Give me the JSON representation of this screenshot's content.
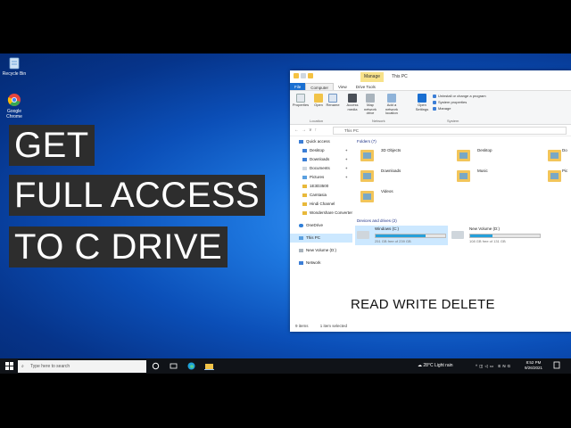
{
  "desktop": {
    "icons": [
      {
        "label": "Recycle Bin",
        "icon": "recycle-bin-icon"
      },
      {
        "label": "Google Chrome",
        "icon": "chrome-icon"
      }
    ],
    "banner": [
      "GET",
      "FULL ACCESS",
      "TO C DRIVE"
    ]
  },
  "explorer": {
    "title_manage": "Manage",
    "title": "This PC",
    "tabs": [
      "File",
      "Computer",
      "View",
      "Drive Tools"
    ],
    "ribbon": {
      "buttons": [
        "Properties",
        "Open",
        "Rename",
        "Access media",
        "Map network drive",
        "Add a network location",
        "Open Settings"
      ],
      "links": [
        "Uninstall or change a program",
        "System properties",
        "Manage"
      ],
      "groups": [
        "Location",
        "Network",
        "System"
      ]
    },
    "address": "This PC",
    "nav": {
      "quick_access": "Quick access",
      "items": [
        "Desktop",
        "Downloads",
        "Documents",
        "Pictures",
        "1E3D3500",
        "Camtasia",
        "Hindi Channel",
        "Wondershare Converter"
      ],
      "onedrive": "OneDrive",
      "this_pc": "This PC",
      "new_volume": "New Volume (D:)",
      "network": "Network"
    },
    "folders_header": "Folders (7)",
    "folders": [
      "3D Objects",
      "Desktop",
      "Do",
      "Downloads",
      "Music",
      "Pic",
      "Videos"
    ],
    "drives_header": "Devices and drives (2)",
    "drives": [
      {
        "label": "Windows (C:)",
        "free": "251 GB free of 239 GB",
        "used_fraction": 0.72
      },
      {
        "label": "New Volume (D:)",
        "free": "108 GB free of 131 GB",
        "used_fraction": 0.32
      }
    ],
    "overlay_text": "READ WRITE DELETE",
    "status_items": "9 items",
    "status_selected": "1 item selected"
  },
  "taskbar": {
    "search_placeholder": "Type here to search",
    "weather": "28°C  Light rain",
    "lang": "ENG",
    "time": "8:52 PM",
    "date": "9/26/2021"
  }
}
